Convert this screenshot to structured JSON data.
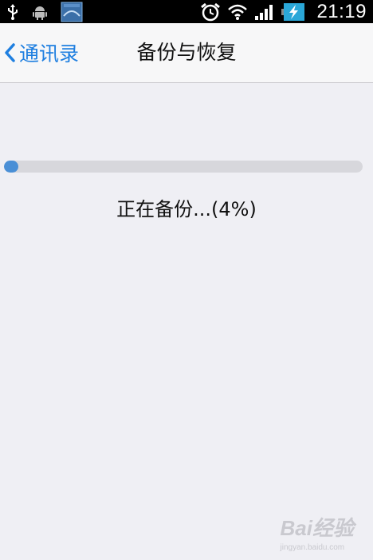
{
  "status_bar": {
    "time": "21:19",
    "icons": [
      "usb-icon",
      "android-icon",
      "app-notification-icon",
      "alarm-icon",
      "wifi-icon",
      "signal-icon",
      "battery-charging-icon"
    ]
  },
  "nav": {
    "back_label": "通讯录",
    "title": "备份与恢复"
  },
  "progress": {
    "percent": 4,
    "status_text": "正在备份...(4%)"
  },
  "watermark": {
    "text": "Bai经验",
    "sub": "jingyan.baidu.com"
  },
  "colors": {
    "accent": "#1f7fe0",
    "progress_fill": "#4a8fd6",
    "background": "#efeff4"
  }
}
